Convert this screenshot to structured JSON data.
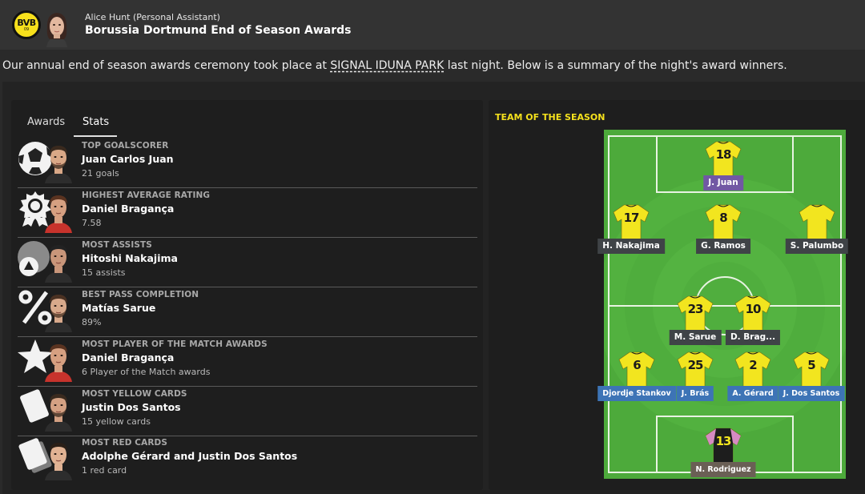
{
  "header": {
    "club_crest_text": "BVB",
    "club_crest_sub": "09",
    "sender": "Alice Hunt  (Personal Assistant)",
    "subject": "Borussia Dortmund End of Season Awards"
  },
  "summary": {
    "before": "Our annual end of season awards ceremony took place at ",
    "stadium": "SIGNAL IDUNA PARK",
    "after": " last night. Below is a summary of the night's award winners."
  },
  "tabs": {
    "awards": "Awards",
    "stats": "Stats",
    "active": "Stats"
  },
  "awards": [
    {
      "title": "TOP GOALSCORER",
      "winner": "Juan Carlos Juan",
      "detail": "21 goals",
      "icon": "football-icon"
    },
    {
      "title": "HIGHEST AVERAGE RATING",
      "winner": "Daniel Bragança",
      "detail": "7.58",
      "icon": "rating-badge-icon"
    },
    {
      "title": "MOST ASSISTS",
      "winner": "Hitoshi Nakajima",
      "detail": "15 assists",
      "icon": "assist-icon"
    },
    {
      "title": "BEST PASS COMPLETION",
      "winner": "Matías Sarue",
      "detail": "89%",
      "icon": "percent-icon"
    },
    {
      "title": "MOST PLAYER OF THE MATCH AWARDS",
      "winner": "Daniel Bragança",
      "detail": "6 Player of the Match awards",
      "icon": "star-icon"
    },
    {
      "title": "MOST YELLOW CARDS",
      "winner": "Justin Dos Santos",
      "detail": "15 yellow cards",
      "icon": "yellow-card-icon"
    },
    {
      "title": "MOST RED CARDS",
      "winner": "Adolphe Gérard and Justin Dos Santos",
      "detail": "1 red card",
      "icon": "red-card-icon"
    }
  ],
  "team_of_season": {
    "title": "TEAM OF THE SEASON",
    "players": [
      {
        "name": "J. Juan",
        "number": "18",
        "role": "fw"
      },
      {
        "name": "H. Nakajima",
        "number": "17",
        "role": "mf"
      },
      {
        "name": "G. Ramos",
        "number": "8",
        "role": "mf"
      },
      {
        "name": "S. Palumbo",
        "number": "",
        "role": "mf"
      },
      {
        "name": "M. Sarue",
        "number": "23",
        "role": "mf"
      },
      {
        "name": "D. Brag...",
        "number": "10",
        "role": "mf"
      },
      {
        "name": "Djordje Stankov",
        "number": "6",
        "role": "df"
      },
      {
        "name": "J. Brás",
        "number": "25",
        "role": "df"
      },
      {
        "name": "A. Gérard",
        "number": "2",
        "role": "df"
      },
      {
        "name": "J. Dos Santos",
        "number": "5",
        "role": "df"
      },
      {
        "name": "N. Rodriguez",
        "number": "13",
        "role": "gk"
      }
    ]
  },
  "colors": {
    "shirt_yellow": "#f2e51f",
    "keeper_pink": "#d68bc2",
    "pitch_green": "#56b33f",
    "accent_yellow": "#f5e11d"
  }
}
